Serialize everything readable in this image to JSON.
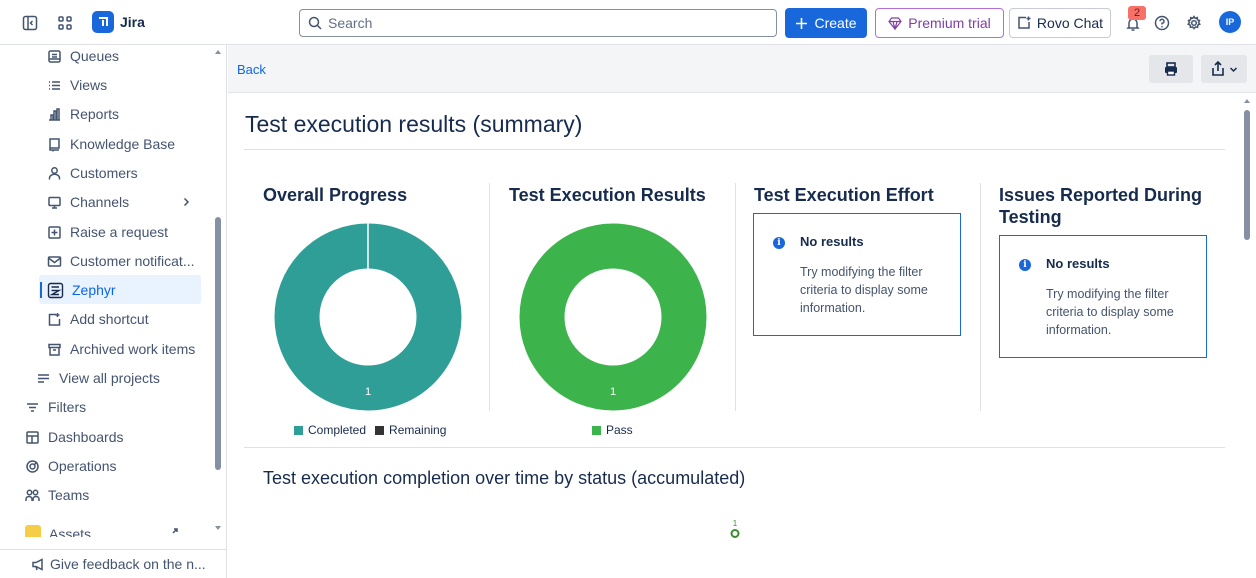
{
  "topbar": {
    "app_name": "Jira",
    "search_placeholder": "Search",
    "create_label": "Create",
    "premium_label": "Premium trial",
    "rovo_label": "Rovo Chat",
    "notification_count": "2",
    "avatar_initials": "IP"
  },
  "sidebar": {
    "items": [
      {
        "label": "Queues",
        "icon": "queue-icon"
      },
      {
        "label": "Views",
        "icon": "list-icon"
      },
      {
        "label": "Reports",
        "icon": "chart-icon"
      },
      {
        "label": "Knowledge Base",
        "icon": "book-icon"
      },
      {
        "label": "Customers",
        "icon": "person-icon"
      },
      {
        "label": "Channels",
        "icon": "monitor-icon"
      },
      {
        "label": "Raise a request",
        "icon": "plus-box-icon"
      },
      {
        "label": "Customer notificat...",
        "icon": "mail-icon"
      },
      {
        "label": "Zephyr",
        "icon": "zephyr-icon"
      },
      {
        "label": "Add shortcut",
        "icon": "add-shortcut-icon"
      },
      {
        "label": "Archived work items",
        "icon": "archive-icon"
      },
      {
        "label": "View all projects",
        "icon": "lines-icon"
      },
      {
        "label": "Filters",
        "icon": "filter-icon"
      },
      {
        "label": "Dashboards",
        "icon": "dashboard-icon"
      },
      {
        "label": "Operations",
        "icon": "operations-icon"
      },
      {
        "label": "Teams",
        "icon": "teams-icon"
      },
      {
        "label": "Assets",
        "icon": "assets-icon"
      }
    ],
    "feedback": "Give feedback on the n..."
  },
  "content": {
    "back_label": "Back",
    "page_title": "Test execution results (summary)",
    "panels": {
      "overall_progress": {
        "title": "Overall Progress",
        "legend": [
          "Completed",
          "Remaining"
        ],
        "value_label": "1"
      },
      "execution_results": {
        "title": "Test Execution Results",
        "legend": [
          "Pass"
        ],
        "value_label": "1"
      },
      "execution_effort": {
        "title": "Test Execution Effort",
        "no_results_title": "No results",
        "no_results_text": "Try modifying the filter criteria to display some information."
      },
      "issues_reported": {
        "title_line1": "Issues Reported During",
        "title_line2": "Testing",
        "no_results_title": "No results",
        "no_results_text": "Try modifying the filter criteria to display some information."
      }
    },
    "completion_title": "Test execution completion over time by status (accumulated)",
    "completion_point_label": "1"
  },
  "colors": {
    "brand": "#1868db",
    "completed": "#2f9e97",
    "remaining": "#333333",
    "pass": "#3cb44b"
  },
  "chart_data": [
    {
      "type": "pie",
      "title": "Overall Progress",
      "categories": [
        "Completed",
        "Remaining"
      ],
      "values": [
        1,
        0
      ]
    },
    {
      "type": "pie",
      "title": "Test Execution Results",
      "categories": [
        "Pass"
      ],
      "values": [
        1
      ]
    }
  ]
}
